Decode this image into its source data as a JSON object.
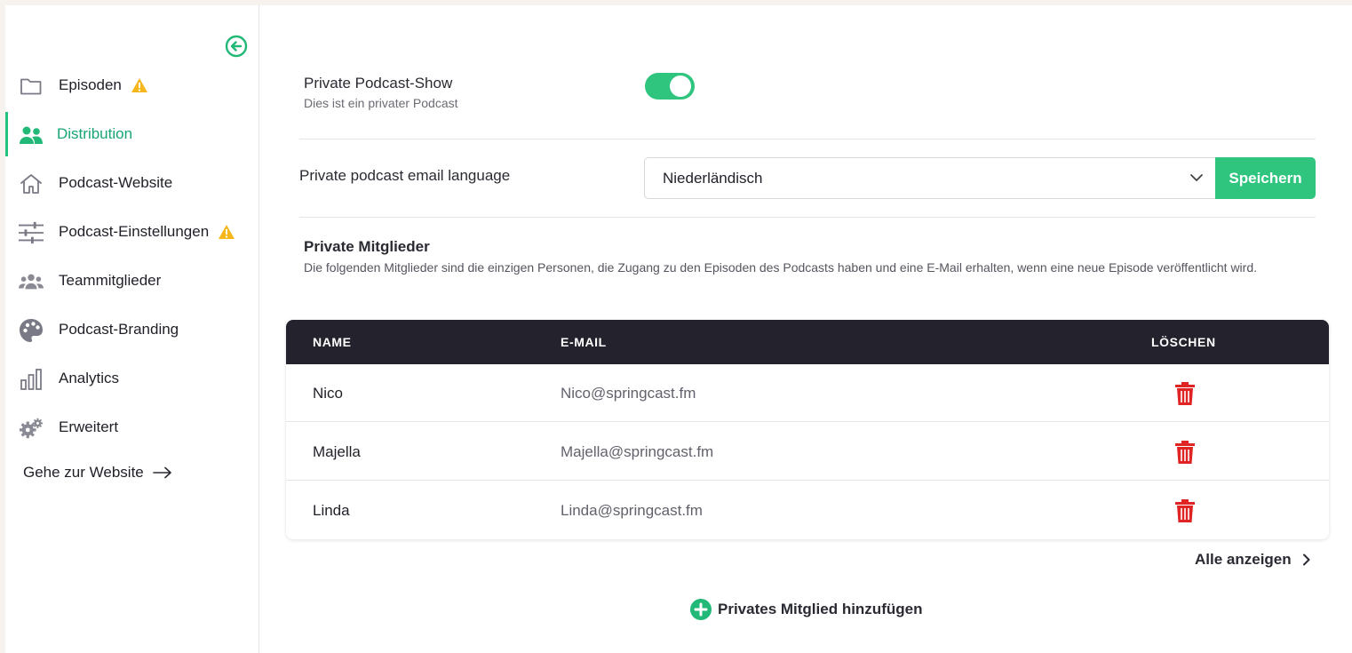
{
  "sidebar": {
    "items": [
      {
        "label": "Episoden",
        "icon": "folder-icon",
        "warning": true
      },
      {
        "label": "Distribution",
        "icon": "users-icon",
        "active": true
      },
      {
        "label": "Podcast-Website",
        "icon": "home-icon"
      },
      {
        "label": "Podcast-Einstellungen",
        "icon": "sliders-icon",
        "warning": true
      },
      {
        "label": "Teammitglieder",
        "icon": "team-icon"
      },
      {
        "label": "Podcast-Branding",
        "icon": "palette-icon"
      },
      {
        "label": "Analytics",
        "icon": "bar-chart-icon"
      },
      {
        "label": "Erweitert",
        "icon": "gears-icon"
      }
    ],
    "goto_website": "Gehe zur Website"
  },
  "private_show": {
    "title": "Private Podcast-Show",
    "subtitle": "Dies ist ein privater Podcast",
    "enabled": true
  },
  "email_language": {
    "label": "Private podcast email language",
    "selected": "Niederländisch",
    "save_label": "Speichern"
  },
  "members": {
    "title": "Private Mitglieder",
    "description": "Die folgenden Mitglieder sind die einzigen Personen, die Zugang zu den Episoden des Podcasts haben und eine E-Mail erhalten, wenn eine neue Episode veröffentlicht wird.",
    "columns": {
      "name": "NAME",
      "email": "E-MAIL",
      "delete": "LÖSCHEN"
    },
    "rows": [
      {
        "name": "Nico",
        "email": "Nico@springcast.fm"
      },
      {
        "name": "Majella",
        "email": "Majella@springcast.fm"
      },
      {
        "name": "Linda",
        "email": "Linda@springcast.fm"
      }
    ],
    "show_all": "Alle anzeigen",
    "add_member": "Privates Mitglied hinzufügen"
  },
  "colors": {
    "accent": "#2fc57f",
    "danger": "#e02424",
    "warning": "#f6b71d",
    "table_header": "#24222c"
  }
}
